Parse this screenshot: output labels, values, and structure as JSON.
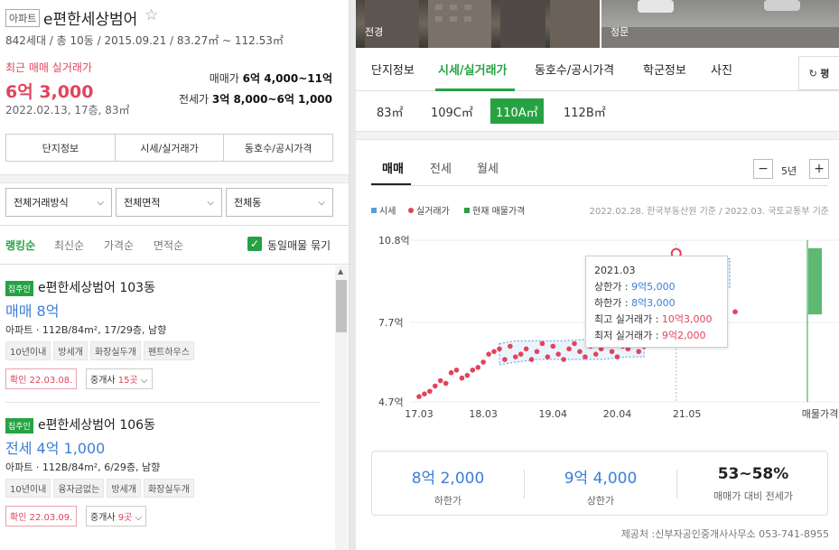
{
  "complex": {
    "type_badge": "아파트",
    "name": "e편한세상범어",
    "star": "☆",
    "meta": "842세대 / 총 10동 / 2015.09.21 / 83.27㎡ ~ 112.53㎡",
    "recent_label": "최근 매매 실거래가",
    "recent_price": "6억 3,000",
    "recent_date": "2022.02.13, 17층, 83㎡",
    "sale_label": "매매가",
    "sale_range": "6억 4,000~11억",
    "jeonse_label": "전세가",
    "jeonse_range": "3억 8,000~6억 1,000"
  },
  "left_tabs": [
    "단지정보",
    "시세/실거래가",
    "동호수/공시가격"
  ],
  "filters": [
    "전체거래방식",
    "전체면적",
    "전체동"
  ],
  "sort": {
    "options": [
      "랭킹순",
      "최신순",
      "가격순",
      "면적순"
    ],
    "active": "랭킹순",
    "same_listing_label": "동일매물 묶기",
    "same_listing_checked": true
  },
  "listings": [
    {
      "owner_badge": "집주인",
      "title": "e편한세상범어 103동",
      "price": "매매 8억",
      "desc": "아파트 · 112B/84m², 17/29층, 남향",
      "tags": [
        "10년이내",
        "방세개",
        "화장실두개",
        "펜트하우스"
      ],
      "confirm": "확인 22.03.08.",
      "agent_prefix": "중개사",
      "agent_count": "15곳"
    },
    {
      "owner_badge": "집주인",
      "title": "e편한세상범어 106동",
      "price": "전세 4억 1,000",
      "desc": "아파트 · 112B/84m², 6/29층, 남향",
      "tags": [
        "10년이내",
        "융자금없는",
        "방세개",
        "화장실두개"
      ],
      "confirm": "확인 22.03.09.",
      "agent_prefix": "중개사",
      "agent_count": "9곳"
    }
  ],
  "photos": [
    "전경",
    "정문"
  ],
  "main_tabs": [
    "단지정보",
    "시세/실거래가",
    "동호수/공시가격",
    "학군정보",
    "사진"
  ],
  "active_main_tab": "시세/실거래가",
  "unit_toggle": "평",
  "areas": [
    "83㎡",
    "109C㎡",
    "110A㎡",
    "112B㎡"
  ],
  "active_area": "110A㎡",
  "chart_tabs": [
    "매매",
    "전세",
    "월세"
  ],
  "active_chart_tab": "매매",
  "period": {
    "minus": "−",
    "value": "5년",
    "plus": "+"
  },
  "legend": [
    "시세",
    "실거래가",
    "현재 매물가격"
  ],
  "source_note": "2022.02.28. 한국부동산원 기준 / 2022.03. 국토교통부 기준",
  "tooltip": {
    "date": "2021.03",
    "upper_label": "상한가 :",
    "upper": "9억5,000",
    "lower_label": "하한가 :",
    "lower": "8억3,000",
    "max_label": "최고 실거래가 :",
    "max": "10억3,000",
    "min_label": "최저 실거래가 :",
    "min": "9억2,000"
  },
  "summary": [
    {
      "value": "8억 2,000",
      "label": "하한가"
    },
    {
      "value": "9억 4,000",
      "label": "상한가"
    },
    {
      "value": "53~58%",
      "label": "매매가 대비 전세가"
    }
  ],
  "footer": "제공처 :신부자공인중개사사무소 053-741-8955",
  "colors": {
    "accent": "#27a243",
    "price_red": "#e2435c",
    "price_blue": "#3a7fd9",
    "band_blue": "#5b9be0"
  },
  "chart_data": {
    "type": "scatter",
    "title": "",
    "xlabel": "",
    "ylabel": "",
    "y_ticks": [
      "10.8억",
      "7.7억",
      "4.7억"
    ],
    "x_ticks": [
      "17.03",
      "18.03",
      "19.04",
      "20.04",
      "21.05",
      "매물가격"
    ],
    "ylim": [
      4.7,
      10.8
    ],
    "series": [
      {
        "name": "실거래가",
        "points": [
          [
            "2017-03",
            4.9
          ],
          [
            "2017-04",
            5.0
          ],
          [
            "2017-05",
            5.1
          ],
          [
            "2017-06",
            5.3
          ],
          [
            "2017-07",
            5.5
          ],
          [
            "2017-08",
            5.4
          ],
          [
            "2017-09",
            5.8
          ],
          [
            "2017-10",
            5.9
          ],
          [
            "2017-11",
            5.6
          ],
          [
            "2017-12",
            5.7
          ],
          [
            "2018-01",
            5.9
          ],
          [
            "2018-02",
            6.0
          ],
          [
            "2018-03",
            6.2
          ],
          [
            "2018-04",
            6.5
          ],
          [
            "2018-05",
            6.6
          ],
          [
            "2018-06",
            6.7
          ],
          [
            "2018-07",
            6.3
          ],
          [
            "2018-08",
            6.8
          ],
          [
            "2018-09",
            6.4
          ],
          [
            "2018-10",
            6.5
          ],
          [
            "2018-11",
            6.7
          ],
          [
            "2018-12",
            6.3
          ],
          [
            "2019-01",
            6.6
          ],
          [
            "2019-02",
            6.9
          ],
          [
            "2019-03",
            6.4
          ],
          [
            "2019-04",
            6.8
          ],
          [
            "2019-05",
            6.5
          ],
          [
            "2019-06",
            6.3
          ],
          [
            "2019-07",
            6.7
          ],
          [
            "2019-08",
            6.9
          ],
          [
            "2019-09",
            6.6
          ],
          [
            "2019-10",
            6.4
          ],
          [
            "2019-11",
            6.8
          ],
          [
            "2019-12",
            6.5
          ],
          [
            "2020-01",
            6.7
          ],
          [
            "2020-02",
            6.9
          ],
          [
            "2020-03",
            6.6
          ],
          [
            "2020-04",
            6.4
          ],
          [
            "2020-05",
            6.8
          ],
          [
            "2020-06",
            6.7
          ],
          [
            "2020-07",
            6.9
          ],
          [
            "2020-08",
            6.6
          ],
          [
            "2020-09",
            6.8
          ],
          [
            "2021-03",
            10.3
          ],
          [
            "2021-04",
            9.5
          ],
          [
            "2021-04",
            9.2
          ],
          [
            "2021-05",
            9.4
          ],
          [
            "2021-09",
            9.0
          ],
          [
            "2021-10",
            9.0
          ],
          [
            "2021-11",
            8.6
          ],
          [
            "2021-12",
            8.3
          ],
          [
            "2022-02",
            8.1
          ]
        ]
      },
      {
        "name": "시세",
        "lower": "8억 2,000",
        "upper": "9억 4,000"
      },
      {
        "name": "현재 매물가격",
        "range": [
          8.0,
          10.5
        ]
      }
    ]
  }
}
